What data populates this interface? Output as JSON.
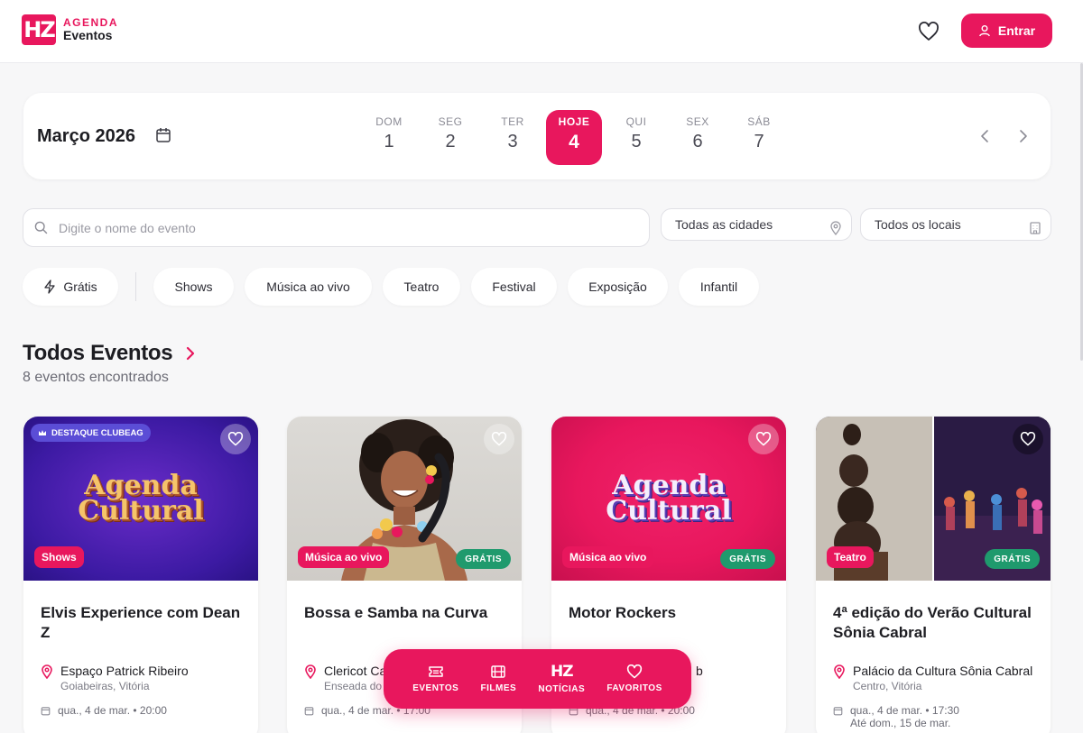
{
  "header": {
    "logo_mark": "HZ",
    "logo_top": "AGENDA",
    "logo_bottom": "Eventos",
    "login_label": "Entrar"
  },
  "calendar": {
    "month": "Março 2026",
    "days": [
      {
        "name": "DOM",
        "num": "1"
      },
      {
        "name": "SEG",
        "num": "2"
      },
      {
        "name": "TER",
        "num": "3"
      },
      {
        "name": "HOJE",
        "num": "4",
        "active": true
      },
      {
        "name": "QUI",
        "num": "5"
      },
      {
        "name": "SEX",
        "num": "6"
      },
      {
        "name": "SÁB",
        "num": "7"
      }
    ]
  },
  "search": {
    "placeholder": "Digite o nome do evento",
    "city": "Todas as cidades",
    "location": "Todos os locais"
  },
  "categories": [
    "Grátis",
    "Shows",
    "Música ao vivo",
    "Teatro",
    "Festival",
    "Exposição",
    "Infantil"
  ],
  "section": {
    "title": "Todos Eventos",
    "count": "8 eventos encontrados"
  },
  "events": [
    {
      "badge": "DESTAQUE CLUBEAG",
      "image_text_1": "Agenda",
      "image_text_2": "Cultural",
      "category": "Shows",
      "free": "",
      "title": "Elvis Experience com Dean Z",
      "venue": "Espaço Patrick Ribeiro",
      "area": "Goiabeiras, Vitória",
      "date": "qua., 4 de mar. • 20:00",
      "date_sub": ""
    },
    {
      "badge": "",
      "category": "Música ao vivo",
      "free": "GRÁTIS",
      "title": "Bossa e Samba na Curva",
      "venue": "Clericot Ca",
      "area": "Enseada do",
      "date": "qua., 4 de mar. • 17:00",
      "date_sub": ""
    },
    {
      "badge": "",
      "image_text_1": "Agenda",
      "image_text_2": "Cultural",
      "category": "Música ao vivo",
      "free": "GRÁTIS",
      "title": "Motor Rockers",
      "venue": "b",
      "area": "",
      "date": "qua., 4 de mar. • 20:00",
      "date_sub": ""
    },
    {
      "badge": "",
      "category": "Teatro",
      "free": "GRÁTIS",
      "title": "4ª edição do Verão Cultural Sônia Cabral",
      "venue": "Palácio da Cultura Sônia Cabral",
      "area": "Centro, Vitória",
      "date": "qua., 4 de mar. • 17:30",
      "date_sub": "Até dom., 15 de mar."
    }
  ],
  "bottom_nav": [
    {
      "label": "EVENTOS",
      "icon": "ticket-icon"
    },
    {
      "label": "FILMES",
      "icon": "film-icon"
    },
    {
      "label": "NOTÍCIAS",
      "icon": "hz-logo-icon",
      "glyph": "HZ"
    },
    {
      "label": "FAVORITOS",
      "icon": "heart-icon"
    }
  ],
  "colors": {
    "accent": "#e8175d",
    "free_badge": "#1f9a6d",
    "destaque_badge": "#5b4dd6"
  }
}
